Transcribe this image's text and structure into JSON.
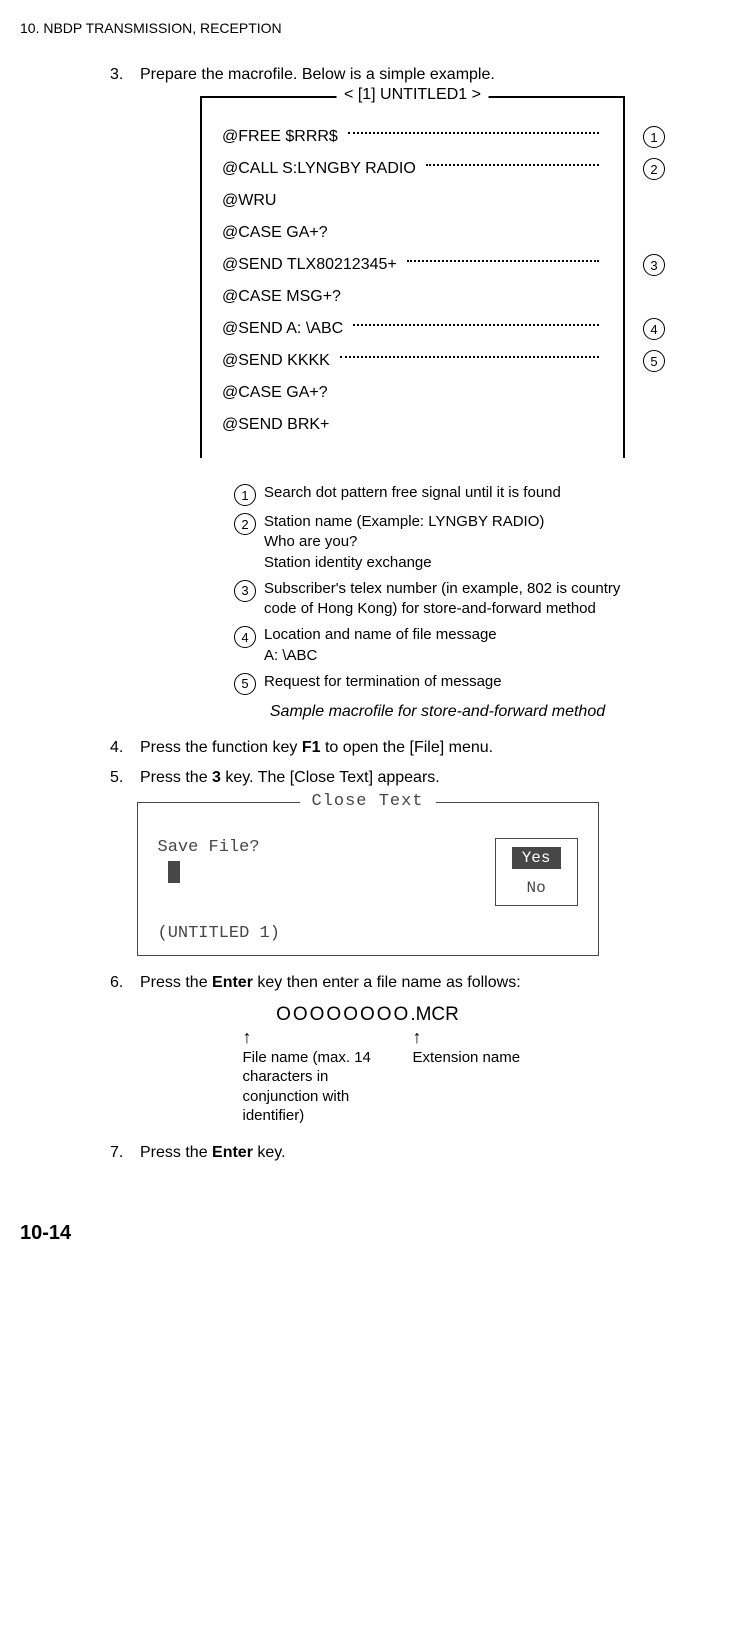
{
  "header": "10.  NBDP TRANSMISSION, RECEPTION",
  "step3": {
    "num": "3.",
    "text_a": "Prepare the macrofile. Below is a simple example."
  },
  "box": {
    "legend": "< [1] UNTITLED1 >",
    "rows": [
      {
        "label": "@FREE $RRR$",
        "note": "1"
      },
      {
        "label": "@CALL S:LYNGBY RADIO",
        "note": "2"
      },
      {
        "label": "@WRU",
        "note": ""
      },
      {
        "label": "@CASE GA+?",
        "note": ""
      },
      {
        "label": "@SEND TLX80212345+",
        "note": "3"
      },
      {
        "label": "@CASE MSG+?",
        "note": ""
      },
      {
        "label": "@SEND A: \\ABC",
        "note": "4"
      },
      {
        "label": "@SEND KKKK",
        "note": "5"
      },
      {
        "label": "@CASE GA+?",
        "note": ""
      },
      {
        "label": "@SEND BRK+",
        "note": ""
      }
    ]
  },
  "legend_items": [
    {
      "n": "1",
      "text": "Search dot pattern free signal until it is found"
    },
    {
      "n": "2",
      "text": "Station name (Example: LYNGBY RADIO)\nWho are you?\nStation identity exchange"
    },
    {
      "n": "3",
      "text": "Subscriber's telex number (in example, 802 is country code of Hong Kong) for store-and-forward method"
    },
    {
      "n": "4",
      "text": "Location and name of file message\nA: \\ABC"
    },
    {
      "n": "5",
      "text": "Request for termination of message"
    }
  ],
  "caption": "Sample macrofile for store-and-forward method",
  "step4": {
    "num": "4.",
    "a": "Press the function key ",
    "b": "F1",
    "c": " to open the [File] menu."
  },
  "step5": {
    "num": "5.",
    "a": "Press the ",
    "b": "3",
    "c": " key. The [Close Text] appears."
  },
  "dialog": {
    "title": "Close Text",
    "prompt": "Save File?",
    "yes": "Yes",
    "no": "No",
    "footer": "(UNTITLED 1)"
  },
  "step6": {
    "num": "6.",
    "a": "Press the ",
    "b": "Enter",
    "c": " key then enter a file name as follows:"
  },
  "fn": {
    "circles": "OOOOOOOO",
    "ext": ".MCR",
    "left": "File name (max. 14 characters in conjunction with identifier)",
    "right": "Extension name"
  },
  "step7": {
    "num": "7.",
    "a": "Press the ",
    "b": "Enter",
    "c": " key."
  },
  "page_num": "10-14"
}
